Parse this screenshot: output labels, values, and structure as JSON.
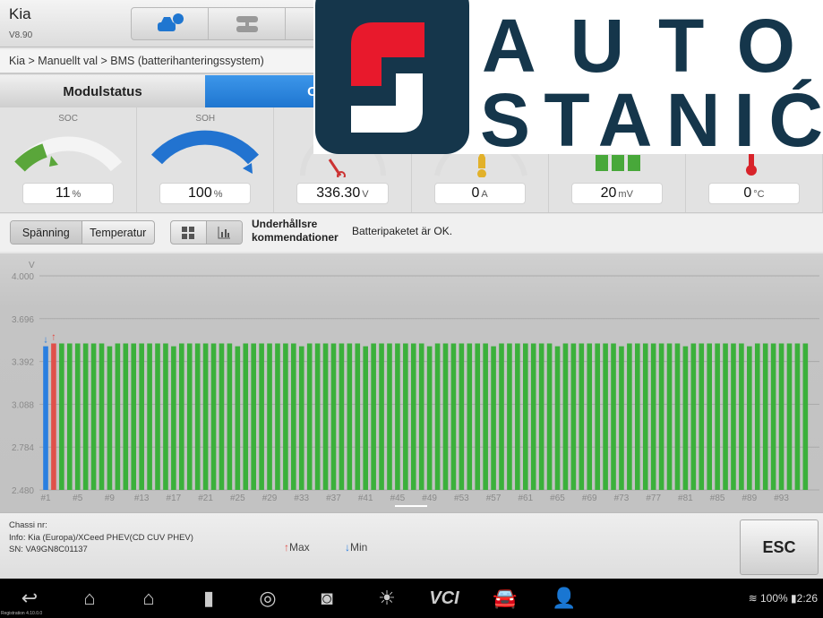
{
  "header": {
    "title": "Kia",
    "version": "V8.90"
  },
  "breadcrumb": "Kia > Manuellt val > BMS (batterihanteringssystem)",
  "tabs": [
    {
      "label": "Modulstatus",
      "active": false
    },
    {
      "label": "Cellstatus",
      "active": true
    }
  ],
  "gauges": [
    {
      "label": "SOC",
      "value": "11",
      "unit": "%",
      "fraction": 0.11
    },
    {
      "label": "SOH",
      "value": "100",
      "unit": "%",
      "fraction": 1.0
    },
    {
      "label": "",
      "value": "336.30",
      "unit": "V"
    },
    {
      "label": "",
      "value": "0",
      "unit": "A"
    },
    {
      "label": "",
      "value": "20",
      "unit": "mV"
    },
    {
      "label": "",
      "value": "0",
      "unit": "°C"
    }
  ],
  "controls": {
    "voltage": "Spänning",
    "temperature": "Temperatur",
    "reco_label_1": "Underhållsre",
    "reco_label_2": "kommendationer",
    "reco_text": "Batteripaketet är OK."
  },
  "footer": {
    "chassis": "Chassi nr:",
    "info": "Info: Kia (Europa)/XCeed PHEV(CD CUV PHEV)",
    "sn": "SN: VA9GN8C01137",
    "max": "Max",
    "min": "Min",
    "esc": "ESC"
  },
  "status": {
    "battery": "100%",
    "time": "2:26",
    "registration": "Registration 4.10.0.0"
  },
  "logo": {
    "line1": "AUTO",
    "line2": "STANIĆ"
  },
  "colors": {
    "accent": "#1f76d0",
    "bar": "#3bb03b",
    "max": "#e0504a",
    "min": "#2a7fe0",
    "logo_dark": "#15364b",
    "logo_red": "#e8192c"
  },
  "chart_data": {
    "type": "bar",
    "unit": "V",
    "ylim": [
      2.48,
      4.0
    ],
    "yticks": [
      "4.000",
      "3.696",
      "3.392",
      "3.088",
      "2.784",
      "2.480"
    ],
    "cell_count": 96,
    "default_value": 3.52,
    "low_value": 3.5,
    "low_cells": [
      1,
      9,
      17,
      25,
      33,
      41,
      49,
      57,
      65,
      73,
      81,
      89
    ],
    "min_cell": 1,
    "max_cell": 2,
    "xtick_every": 4
  }
}
